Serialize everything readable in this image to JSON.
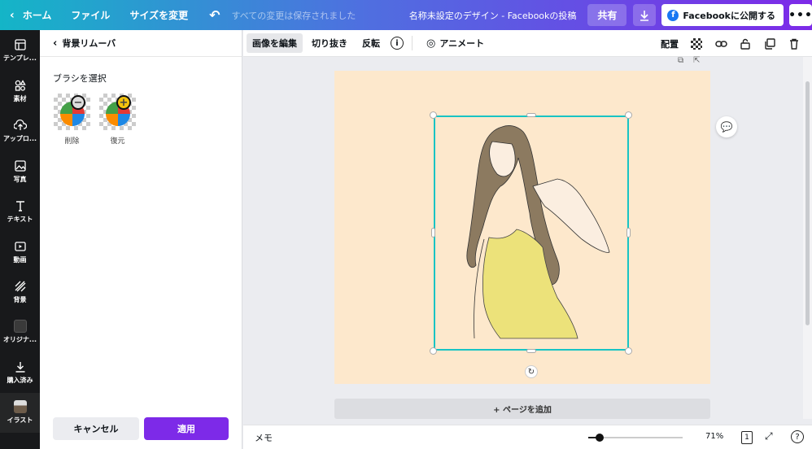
{
  "topbar": {
    "home": "ホーム",
    "file": "ファイル",
    "resize": "サイズを変更",
    "save_status": "すべての変更は保存されました",
    "title": "名称未設定のデザイン - Facebookの投稿",
    "share": "共有",
    "publish": "Facebookに公開する",
    "colors": {
      "gradient_start": "#14b5c7",
      "gradient_end": "#7d2ae8"
    }
  },
  "rail": {
    "items": [
      {
        "label": "テンプレ...",
        "icon": "template-icon"
      },
      {
        "label": "素材",
        "icon": "elements-icon"
      },
      {
        "label": "アップロ...",
        "icon": "upload-icon"
      },
      {
        "label": "写真",
        "icon": "photo-icon"
      },
      {
        "label": "テキスト",
        "icon": "text-icon"
      },
      {
        "label": "動画",
        "icon": "video-icon"
      },
      {
        "label": "背景",
        "icon": "background-icon"
      },
      {
        "label": "オリジナ...",
        "icon": "original-icon"
      },
      {
        "label": "購入済み",
        "icon": "purchased-icon"
      },
      {
        "label": "イラスト",
        "icon": "illustration-thumb"
      }
    ]
  },
  "panel": {
    "title": "背景リムーバ",
    "brush_heading": "ブラシを選択",
    "brushes": [
      {
        "label": "削除",
        "symbol": "−"
      },
      {
        "label": "復元",
        "symbol": "+"
      }
    ],
    "cancel": "キャンセル",
    "apply": "適用",
    "accent_color": "#7d2ae8"
  },
  "toolbar": {
    "edit_image": "画像を編集",
    "crop": "切り抜き",
    "flip": "反転",
    "info": "i",
    "animate": "アニメート",
    "position": "配置"
  },
  "canvas": {
    "add_page": "+ ページを追加",
    "page_color": "#fde8cc",
    "selection_color": "#18c4c4"
  },
  "bottombar": {
    "memo": "メモ",
    "zoom": "71%",
    "zoom_level": 0.12,
    "page_count": "1",
    "help": "?"
  }
}
